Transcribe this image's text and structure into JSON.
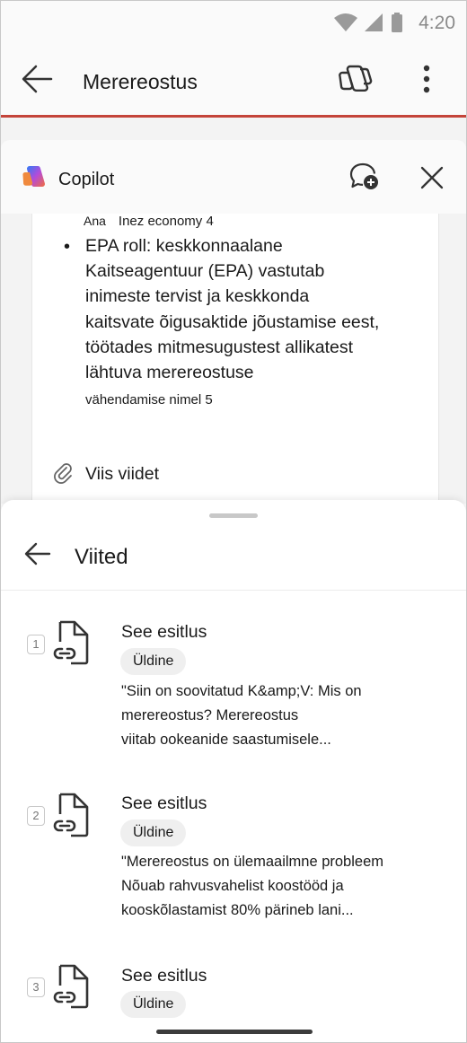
{
  "status_bar": {
    "time": "4:20"
  },
  "app_bar": {
    "title": "Merereostus"
  },
  "copilot": {
    "title": "Copilot",
    "chat": {
      "ref_prefix_1": "Ana",
      "ref_prefix_2": "Inez economy 4",
      "bullet_text": "EPA roll: keskkonnaalane Kaitseagentuur (EPA) vastutab inimeste tervist ja keskkonda kaitsvate õigusaktide jõustamise eest, töötades mitmesugustest allikatest lähtuva merereostuse",
      "bullet_tail": "vähendamise nimel 5",
      "references_link": "Viis viidet"
    }
  },
  "references_sheet": {
    "title": "Viited",
    "items": [
      {
        "num": "1",
        "title": "See esitlus",
        "badge": "Üldine",
        "excerpt": "\"Siin on soovitatud K&amp;V:     Mis on\nmerereostus?         Merereostus\nviitab ookeanide saastumisele..."
      },
      {
        "num": "2",
        "title": "See esitlus",
        "badge": "Üldine",
        "excerpt": "\"Merereostus on ülemaailmne probleem\nNõuab rahvusvahelist koostööd ja\nkooskõlastamist 80% pärineb lani..."
      },
      {
        "num": "3",
        "title": "See esitlus",
        "badge": "Üldine",
        "excerpt": ""
      }
    ]
  }
}
